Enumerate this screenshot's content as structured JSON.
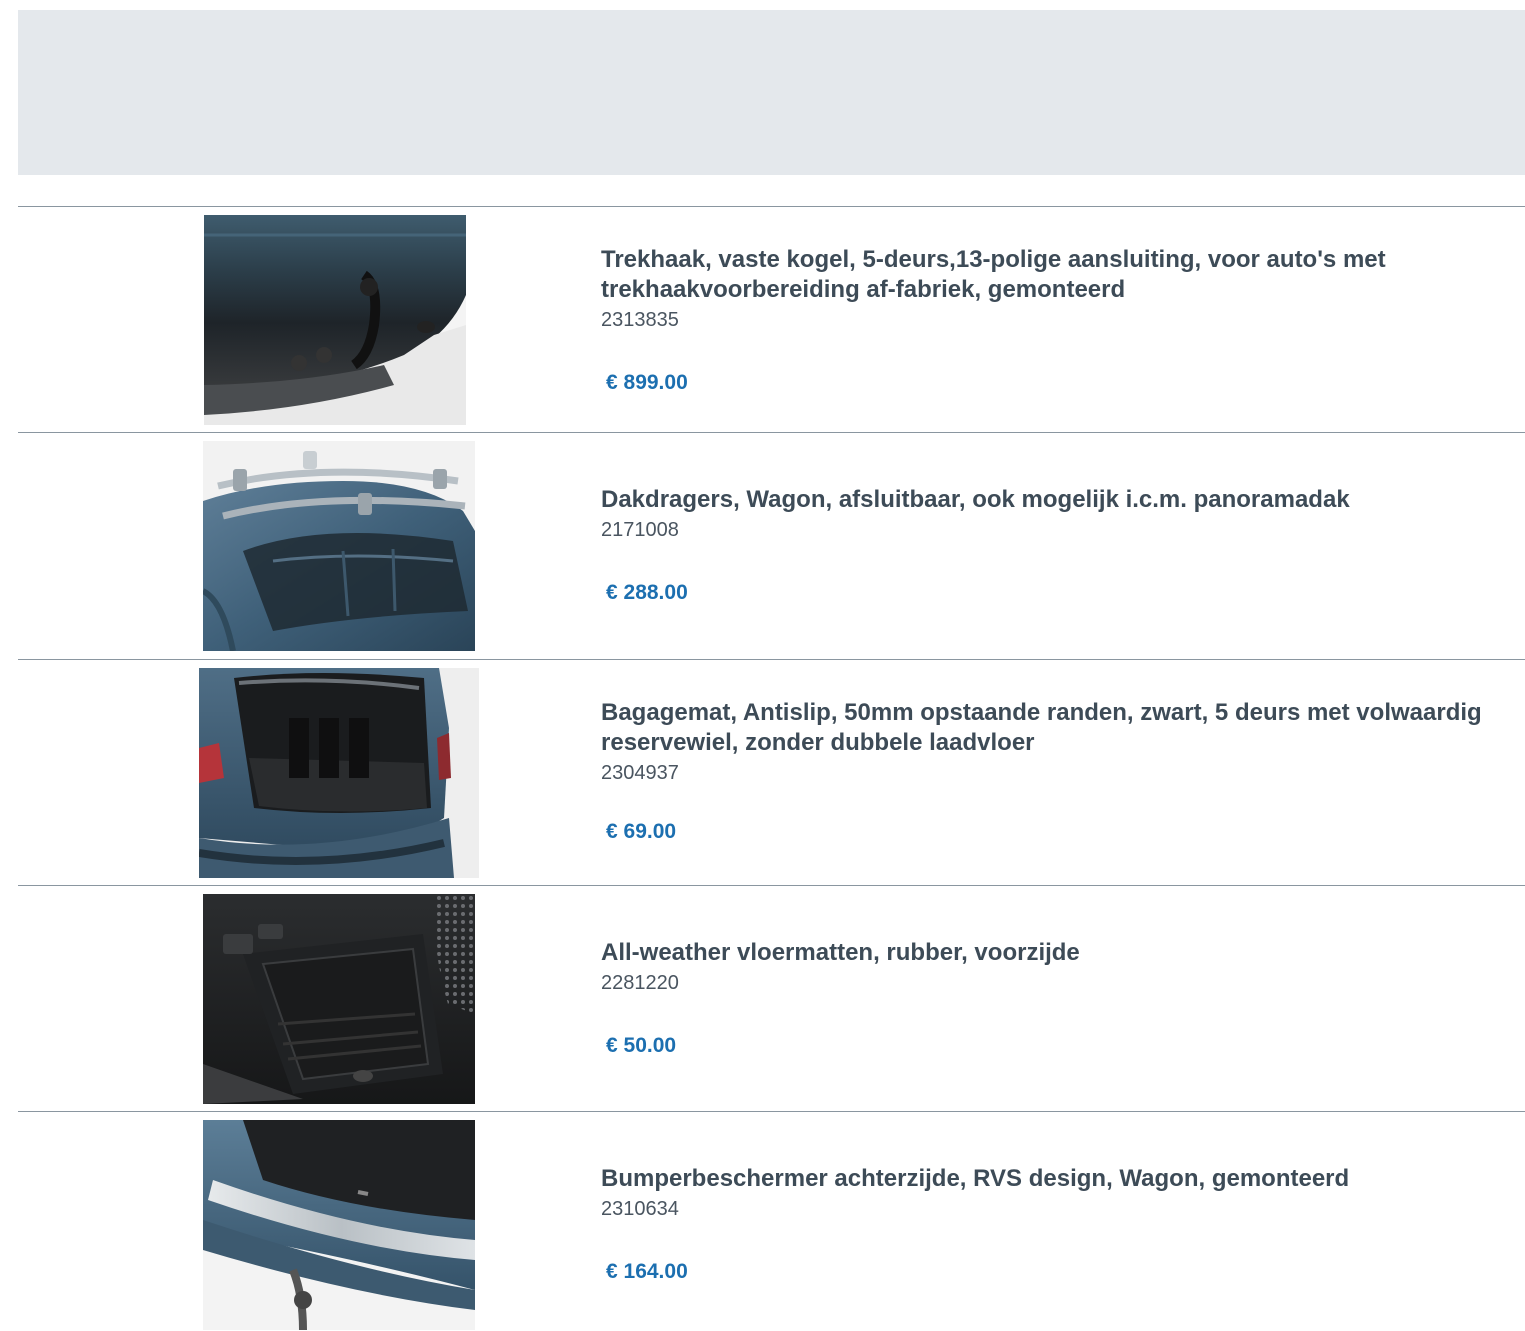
{
  "products": [
    {
      "title": "Trekhaak, vaste kogel, 5-deurs,13-polige aansluiting, voor auto's met trekhaakvoorbereiding af-fabriek, gemonteerd",
      "part_number": "2313835",
      "price": "€ 899.00",
      "image": "tow-bar-photo"
    },
    {
      "title": "Dakdragers, Wagon, afsluitbaar, ook mogelijk i.c.m. panoramadak",
      "part_number": "2171008",
      "price": "€ 288.00",
      "image": "roof-rack-photo"
    },
    {
      "title": "Bagagemat, Antislip, 50mm opstaande randen, zwart, 5 deurs met volwaardig reservewiel, zonder dubbele laadvloer",
      "part_number": "2304937",
      "price": "€ 69.00",
      "image": "luggage-mat-photo"
    },
    {
      "title": "All-weather vloermatten, rubber, voorzijde",
      "part_number": "2281220",
      "price": "€ 50.00",
      "image": "floor-mat-photo"
    },
    {
      "title": "Bumperbeschermer achterzijde, RVS design, Wagon, gemonteerd",
      "part_number": "2310634",
      "price": "€ 164.00",
      "image": "bumper-protector-photo"
    }
  ]
}
